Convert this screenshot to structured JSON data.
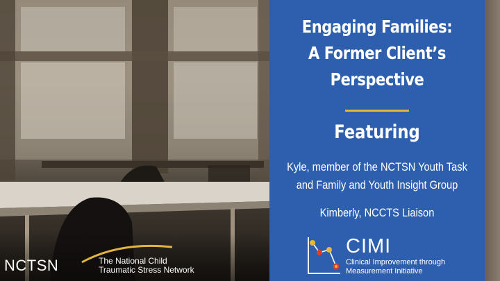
{
  "slide": {
    "title_lines": [
      "Engaging Families:",
      "A Former Client’s",
      "Perspective"
    ],
    "featuring_label": "Featuring",
    "guest1_lines": [
      "Kyle, member of the NCTSN Youth Task",
      "and Family and Youth Insight Group"
    ],
    "guest2": "Kimberly, NCCTS Liaison"
  },
  "logos": {
    "nctsn": {
      "wordmark": "NCTSN",
      "tagline_lines": [
        "The National Child",
        "Traumatic Stress Network"
      ]
    },
    "cimi": {
      "name": "CIMI",
      "subtitle_lines": [
        "Clinical Improvement through",
        "Measurement Initiative"
      ]
    }
  },
  "colors": {
    "panel_blue": "#2d5fae",
    "accent_gold": "#e1b53d",
    "cimi_dot_red": "#d9412c",
    "cimi_dot_gold": "#e9b83a"
  },
  "background_photo": "empty-classroom-desks-and-chairs-by-window"
}
